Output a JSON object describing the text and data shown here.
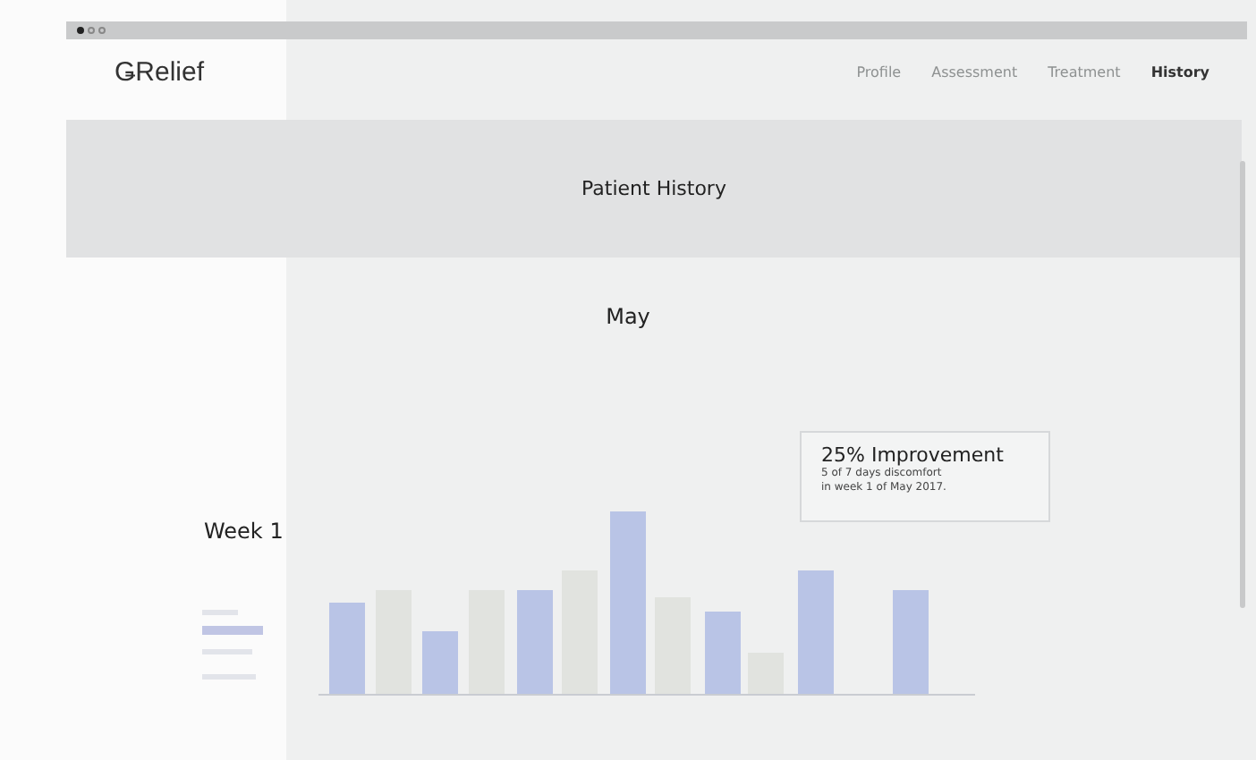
{
  "browser": {
    "dots": [
      {
        "selected": true
      },
      {
        "selected": false
      },
      {
        "selected": false
      }
    ]
  },
  "logo": "ǤRelief",
  "nav": [
    {
      "label": "Profile",
      "selected": false
    },
    {
      "label": "Assessment",
      "selected": false
    },
    {
      "label": "Treatment",
      "selected": false
    },
    {
      "label": "History",
      "selected": true
    }
  ],
  "header": {
    "title": "Patient History"
  },
  "month": "May",
  "week": "Week 1",
  "callout": {
    "title": "25% Improvement",
    "lines": [
      "5 of 7 days discomfort",
      "in week 1 of May 2017."
    ]
  }
}
